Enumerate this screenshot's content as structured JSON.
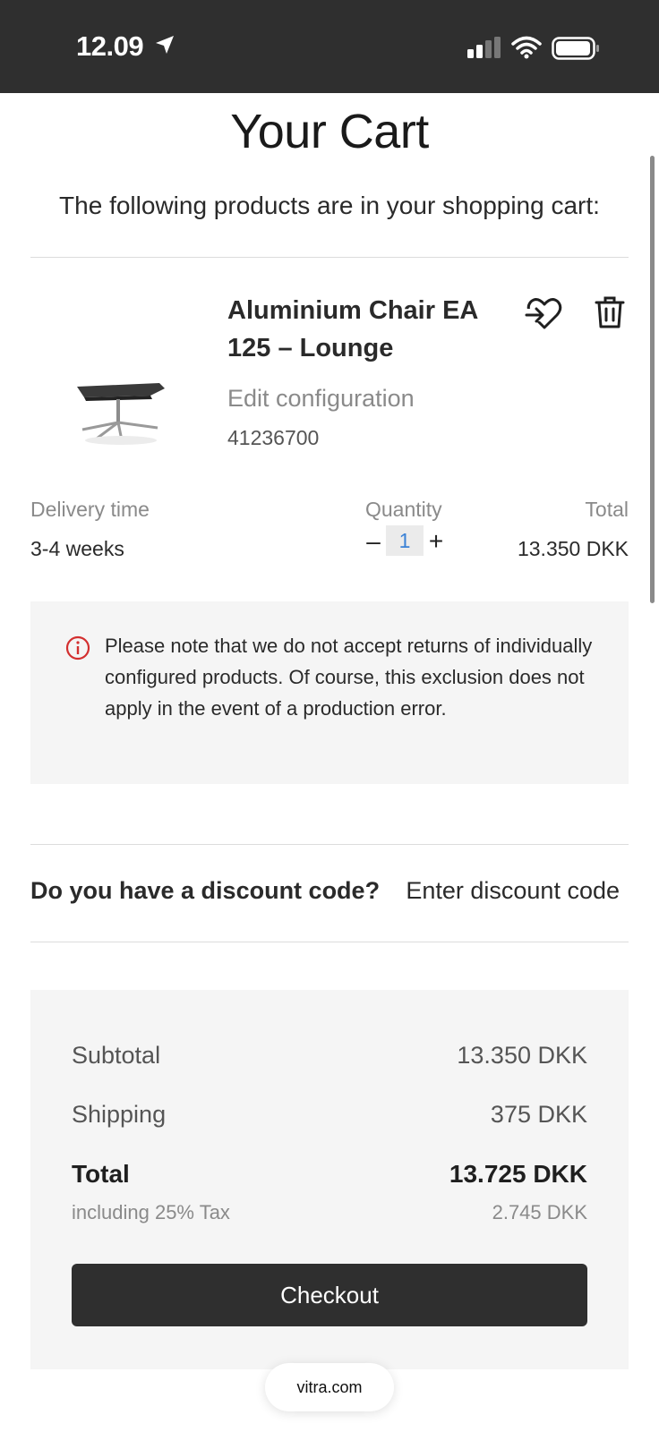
{
  "status_bar": {
    "time": "12.09",
    "icons": [
      "location-arrow-icon",
      "cellular-signal-icon",
      "wifi-icon",
      "battery-icon"
    ]
  },
  "page": {
    "title": "Your Cart",
    "intro": "The following products are in your shopping cart:"
  },
  "product": {
    "name": "Aluminium Chair EA 125 – Lounge",
    "edit_label": "Edit configuration",
    "sku": "41236700",
    "image_icon": "chair-image",
    "delivery_label": "Delivery time",
    "delivery_value": "3-4 weeks",
    "quantity_label": "Quantity",
    "quantity_minus": "–",
    "quantity_value": "1",
    "quantity_plus": "+",
    "total_label": "Total",
    "total_value": "13.350 DKK"
  },
  "notice": {
    "text": "Please note that we do not accept returns of individually configured products. Of course, this exclusion does not apply in the event of a production error."
  },
  "discount": {
    "question": "Do you have a discount code?",
    "link": "Enter discount code"
  },
  "summary": {
    "subtotal_label": "Subtotal",
    "subtotal_value": "13.350 DKK",
    "shipping_label": "Shipping",
    "shipping_value": "375 DKK",
    "total_label": "Total",
    "total_value": "13.725 DKK",
    "tax_label": "including 25% Tax",
    "tax_value": "2.745 DKK",
    "checkout_label": "Checkout"
  },
  "browser": {
    "url": "vitra.com"
  },
  "colors": {
    "status_bar": "#2f2f2f",
    "panel": "#f5f5f5",
    "button": "#2f2f2f",
    "quantity_text": "#3b82d6",
    "info_icon": "#d32f2f"
  }
}
